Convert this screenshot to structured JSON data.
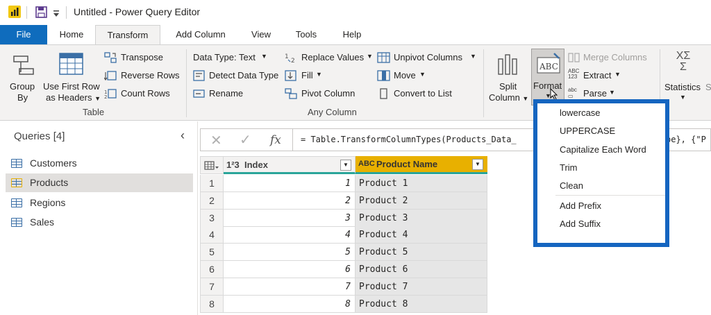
{
  "window": {
    "title": "Untitled - Power Query Editor"
  },
  "tabs": {
    "file": "File",
    "home": "Home",
    "transform": "Transform",
    "add_column": "Add Column",
    "view": "View",
    "tools": "Tools",
    "help": "Help"
  },
  "ribbon": {
    "group_by": [
      "Group",
      "By"
    ],
    "use_first_row": [
      "Use First Row",
      "as Headers"
    ],
    "transpose": "Transpose",
    "reverse_rows": "Reverse Rows",
    "count_rows": "Count Rows",
    "table_group": "Table",
    "data_type": "Data Type: Text",
    "detect_data_type": "Detect Data Type",
    "rename": "Rename",
    "replace_values": "Replace Values",
    "fill": "Fill",
    "pivot_column": "Pivot Column",
    "unpivot_columns": "Unpivot Columns",
    "move": "Move",
    "convert_to_list": "Convert to List",
    "any_column_group": "Any Column",
    "split_column": [
      "Split",
      "Column"
    ],
    "format": "Format",
    "merge_columns": "Merge Columns",
    "extract": "Extract",
    "parse": "Parse",
    "statistics": "Statistics",
    "cut_letter": "S"
  },
  "queries": {
    "title": "Queries [4]",
    "items": [
      "Customers",
      "Products",
      "Regions",
      "Sales"
    ],
    "selected": "Products"
  },
  "formula_bar": {
    "fx": "fx",
    "text": "= Table.TransformColumnTypes(Products_Data_",
    "tail": "pe}, {\"P"
  },
  "grid": {
    "columns": [
      {
        "name": "Index",
        "type_icon": "1²3"
      },
      {
        "name": "Product Name",
        "type_icon": "ABC"
      }
    ],
    "rows": [
      {
        "row": "1",
        "index": "1",
        "name": "Product 1"
      },
      {
        "row": "2",
        "index": "2",
        "name": "Product 2"
      },
      {
        "row": "3",
        "index": "3",
        "name": "Product 3"
      },
      {
        "row": "4",
        "index": "4",
        "name": "Product 4"
      },
      {
        "row": "5",
        "index": "5",
        "name": "Product 5"
      },
      {
        "row": "6",
        "index": "6",
        "name": "Product 6"
      },
      {
        "row": "7",
        "index": "7",
        "name": "Product 7"
      },
      {
        "row": "8",
        "index": "8",
        "name": "Product 8"
      }
    ]
  },
  "format_menu": {
    "items": [
      "lowercase",
      "UPPERCASE",
      "Capitalize Each Word",
      "Trim",
      "Clean",
      "Add Prefix",
      "Add Suffix"
    ]
  },
  "colors": {
    "accent": "#0f6cbd",
    "highlight_col": "#e8b000",
    "callout": "#1565c0"
  }
}
